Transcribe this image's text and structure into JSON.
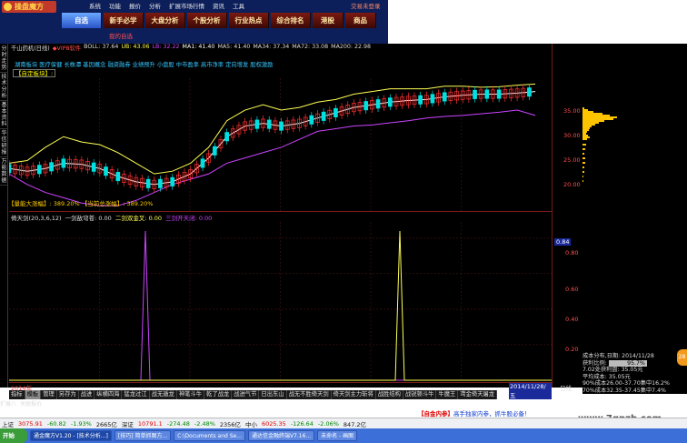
{
  "app": {
    "name": "操盘魔方",
    "menu": [
      "系统",
      "功能",
      "报价",
      "分析",
      "扩展市场行情",
      "资讯",
      "工具"
    ],
    "account": "交易未登录"
  },
  "nav_tabs": [
    "自选",
    "新手必学",
    "大盘分析",
    "个股分析",
    "行业热点",
    "综合排名",
    "港股",
    "商品"
  ],
  "sub_tab": "我的自选",
  "sidebar": [
    "分时走势",
    "技术分析",
    "基本资料",
    "华信研报",
    "万能数据"
  ],
  "info_line": [
    {
      "t": "千山药机(日线)",
      "c": "#dddddd"
    },
    {
      "t": "◆VIP8软件",
      "c": "#ff4d4d"
    },
    {
      "t": "BOLL: 37.64",
      "c": "#dddddd"
    },
    {
      "t": "UB: 43.06",
      "c": "#ffff55"
    },
    {
      "t": "LB: 32.22",
      "c": "#cc44ff"
    },
    {
      "t": "MA1: 41.40",
      "c": "#ffffff"
    },
    {
      "t": "MA5: 41.40",
      "c": "#dddddd"
    },
    {
      "t": "MA34: 37.34",
      "c": "#dddddd"
    },
    {
      "t": "MA72: 33.08",
      "c": "#dddddd"
    },
    {
      "t": "MA200: 22.98",
      "c": "#dddddd"
    }
  ],
  "tags": "湖南板块 医疗保健 长株潭 基因概念 融资融券 业绩预升 小盘股 中市盈率 高市净率 定向增发 股权激励",
  "sector_label": "【自定板块】:",
  "top_chip": "【量能大涨幅】: 389.20% 【当前总涨幅】: 389.20%",
  "indicator_line": [
    {
      "t": "倚天剑(20,3,6,12)",
      "c": "#dddddd"
    },
    {
      "t": "一剑敌穹苍: 0.00",
      "c": "#dddddd"
    },
    {
      "t": "二剑双金叉: 0.00",
      "c": "#ffff55"
    },
    {
      "t": "三剑开天闭: 0.00",
      "c": "#cc44ff"
    }
  ],
  "price_axis": [
    "35.00",
    "30.00",
    "25.00",
    "20.00"
  ],
  "indicator_axis": [
    "0.84",
    "0.80",
    "0.60",
    "0.40",
    "0.20"
  ],
  "date_labels": [
    "2014年",
    "2014/11/28/五",
    "日线"
  ],
  "bottom_tabs": [
    "指标",
    "模板",
    "管理",
    "另存为",
    "战进",
    "纵横四海",
    "猛龙过江",
    "战无遁龙",
    "神笔斗牛",
    "乾了战龙",
    "战进气节",
    "日出东山",
    "战无不胜倚天剑",
    "倚天剑主力斩将",
    "战胜结构",
    "战锐顿斗牛",
    "牛魔王",
    "鸢金倚天屠龙"
  ],
  "bottom_tabs2": [
    "扩展八",
    "关联报价"
  ],
  "stats": {
    "title": "成本分布,日期: 2014/11/28",
    "profit_label": "获利比例:",
    "profit": "95.7%",
    "line1": "7.02处获利盘: 35.05元",
    "line2": "平均成本: 35.05元",
    "line3": "90%成本26.00-37.70集中16.2%",
    "line4": "70%成本32.35-37.45集中7.4%"
  },
  "promo": {
    "text1": "【自金内参】",
    "text2": "高手独家内参，抓牛股必备！"
  },
  "ticker": [
    {
      "t": "上证",
      "c": "#111"
    },
    {
      "t": "3075.91",
      "c": "#d00"
    },
    {
      "t": "-60.82",
      "c": "#080"
    },
    {
      "t": "-1.93%",
      "c": "#080"
    },
    {
      "t": "2665亿",
      "c": "#111"
    },
    {
      "t": "深证",
      "c": "#111"
    },
    {
      "t": "10791.1",
      "c": "#d00"
    },
    {
      "t": "-274.48",
      "c": "#080"
    },
    {
      "t": "-2.48%",
      "c": "#080"
    },
    {
      "t": "2356亿",
      "c": "#111"
    },
    {
      "t": "中小",
      "c": "#111"
    },
    {
      "t": "6025.35",
      "c": "#d00"
    },
    {
      "t": "-126.64",
      "c": "#080"
    },
    {
      "t": "-2.06%",
      "c": "#080"
    },
    {
      "t": "847.2亿",
      "c": "#111"
    }
  ],
  "taskbar": {
    "start": "开始",
    "tasks": [
      "通金魔方V1.20 - [技术分析...]",
      "[技巧] 简单抓图方...",
      "C:\\Documents and Se...",
      "通达信金融终端V7.16...",
      "未命名 - 画图"
    ]
  },
  "watermark": "www.7gpzb.com",
  "chart_data": [
    {
      "type": "line",
      "title": "千山药机(日线)",
      "ylim": [
        15,
        40
      ],
      "x": [
        0,
        10,
        20,
        30,
        40,
        50,
        60,
        70,
        80,
        90,
        100,
        110,
        120,
        130,
        140,
        150,
        160,
        170,
        180,
        190,
        200,
        210,
        220,
        230,
        240,
        250,
        260,
        270,
        280,
        290
      ],
      "series": [
        {
          "name": "UB",
          "color": "#ffff55",
          "values": [
            24,
            24.5,
            27,
            29,
            28,
            27.5,
            26,
            24,
            22,
            22.5,
            24,
            27,
            32,
            34,
            35,
            34,
            34.5,
            35.5,
            36,
            37,
            37.5,
            38,
            38,
            38,
            38.5,
            38.5,
            38.3,
            38.4,
            38.7,
            38.9
          ]
        },
        {
          "name": "LB",
          "color": "#cc44ff",
          "values": [
            22,
            20,
            18.5,
            17.5,
            16.5,
            16,
            16,
            17,
            18.5,
            20,
            21,
            22,
            24,
            25,
            26,
            27,
            28.5,
            30,
            30.5,
            31,
            31.2,
            31.6,
            32,
            32.5,
            32.8,
            33,
            33.3,
            33.6,
            34,
            33
          ]
        },
        {
          "name": "MA",
          "color": "#ffffff",
          "values": [
            23,
            22.5,
            23,
            24,
            23.8,
            23,
            21.5,
            20.5,
            20,
            20.5,
            22,
            25,
            29,
            31,
            31.5,
            31,
            31.5,
            32.5,
            33.5,
            34.5,
            35,
            35.5,
            35.8,
            36,
            36.5,
            36.8,
            37,
            37,
            37.2,
            37.5
          ]
        }
      ]
    },
    {
      "type": "line",
      "title": "倚天剑(20,3,6,12)",
      "ylim": [
        0,
        0.84
      ],
      "series": [
        {
          "name": "一剑敌穹苍",
          "color": "#cc44ff",
          "x": [
            0,
            100,
            140,
            145,
            150,
            155,
            160,
            480,
            597
          ],
          "values": [
            0,
            0,
            0,
            0,
            0.84,
            0,
            0,
            0,
            0
          ]
        },
        {
          "name": "二剑双金叉",
          "color": "#ffff55",
          "x": [
            0,
            420,
            425,
            430,
            435,
            440,
            597
          ],
          "values": [
            0,
            0,
            0,
            0.84,
            0,
            0,
            0
          ]
        }
      ]
    }
  ]
}
